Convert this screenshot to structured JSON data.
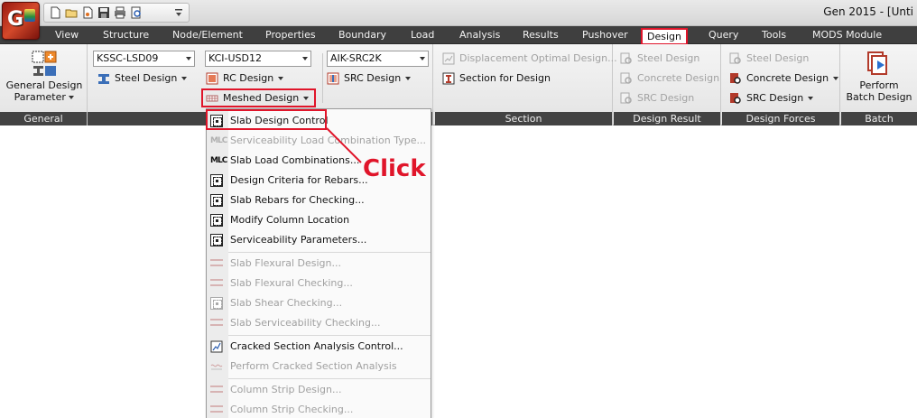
{
  "window": {
    "title": "Gen 2015 - [Unti"
  },
  "menu": {
    "items": [
      "View",
      "Structure",
      "Node/Element",
      "Properties",
      "Boundary",
      "Load",
      "Analysis",
      "Results",
      "Pushover",
      "Design",
      "Query",
      "Tools",
      "MODS Module"
    ],
    "active": "Design"
  },
  "ribbon": {
    "general": {
      "button_label_line1": "General Design",
      "button_label_line2": "Parameter",
      "group_label": "General"
    },
    "codes": {
      "steel_code": "KSSC-LSD09",
      "steel_design": "Steel Design",
      "rc_code": "KCI-USD12",
      "rc_design": "RC Design",
      "meshed_design": "Meshed Design",
      "src_code": "AIK-SRC2K",
      "src_design": "SRC Design"
    },
    "section": {
      "displacement_optimal": "Displacement Optimal Design...",
      "section_for_design": "Section for Design",
      "group_label": "Section"
    },
    "design_result": {
      "steel_design": "Steel Design",
      "concrete_design": "Concrete Design",
      "src_design": "SRC Design",
      "group_label": "Design Result"
    },
    "design_forces": {
      "steel_design": "Steel Design",
      "concrete_design": "Concrete Design",
      "src_design": "SRC Design",
      "group_label": "Design Forces"
    },
    "batch": {
      "button_label_line1": "Perform",
      "button_label_line2": "Batch Design",
      "group_label": "Batch"
    }
  },
  "dropdown": {
    "items": [
      {
        "label": "Slab Design Control",
        "enabled": true,
        "icon": "slab-icon"
      },
      {
        "label": "Serviceability Load Combination Type...",
        "enabled": false,
        "icon": "mlc-icon"
      },
      {
        "label": "Slab Load Combinations...",
        "enabled": true,
        "icon": "mlc-icon"
      },
      {
        "label": "Design Criteria for Rebars...",
        "enabled": true,
        "icon": "slab-icon"
      },
      {
        "label": "Slab Rebars for Checking...",
        "enabled": true,
        "icon": "slab-icon"
      },
      {
        "label": "Modify Column Location",
        "enabled": true,
        "icon": "slab-icon"
      },
      {
        "label": "Serviceability Parameters...",
        "enabled": true,
        "icon": "slab-icon"
      },
      {
        "label": "Slab Flexural Design...",
        "enabled": false,
        "icon": "strip-icon"
      },
      {
        "label": "Slab Flexural Checking...",
        "enabled": false,
        "icon": "strip-icon"
      },
      {
        "label": "Slab Shear Checking...",
        "enabled": false,
        "icon": "slab-icon"
      },
      {
        "label": "Slab Serviceability Checking...",
        "enabled": false,
        "icon": "strip-icon"
      },
      {
        "label": "Cracked Section Analysis Control...",
        "enabled": true,
        "icon": "crack-icon"
      },
      {
        "label": "Perform Cracked Section Analysis",
        "enabled": false,
        "icon": "wave-icon"
      },
      {
        "label": "Column Strip Design...",
        "enabled": false,
        "icon": "strip-icon"
      },
      {
        "label": "Column Strip Checking...",
        "enabled": false,
        "icon": "strip-icon"
      }
    ]
  },
  "annotation": {
    "text": "Click",
    "color": "#e0152a"
  },
  "colors": {
    "accent_red": "#e0152a",
    "menubar": "#3f3f3f",
    "group_label_bg": "#434343"
  }
}
